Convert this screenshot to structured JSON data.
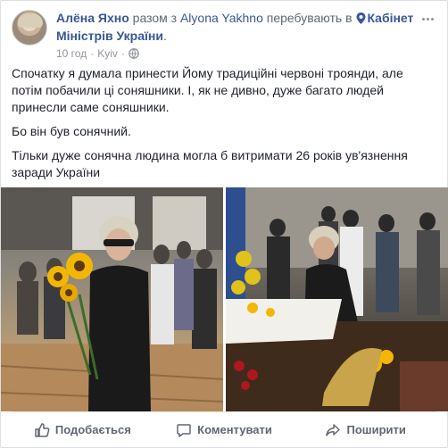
{
  "post": {
    "author": "Алёна Яхно",
    "conj_with": "разом з",
    "tagged": "Alyona Yakhno",
    "verb": "перебувають в",
    "place": "Кабінет Міністрів України",
    "place_suffix": ".",
    "time": "10 год",
    "separator": "·",
    "location": "Kyiv",
    "privacy_icon": "globe-icon",
    "paragraphs": [
      "Спочатку я думала принести Йому традиційні червоні троянди, але потім побачили ці соняшники. І, як не дивно, дуже багато людей принесли саме соняшники.",
      "Бо він був сонячний.",
      "Тільки дуже сонячна людина могла б витримати 26 років ув'язнення заради України"
    ]
  },
  "actions": {
    "like": "Подобається",
    "comment": "Коментувати",
    "share": "Поширити"
  },
  "colors": {
    "link": "#385898",
    "meta": "#90949c",
    "action": "#606770",
    "sunflower": "#f2b705"
  }
}
